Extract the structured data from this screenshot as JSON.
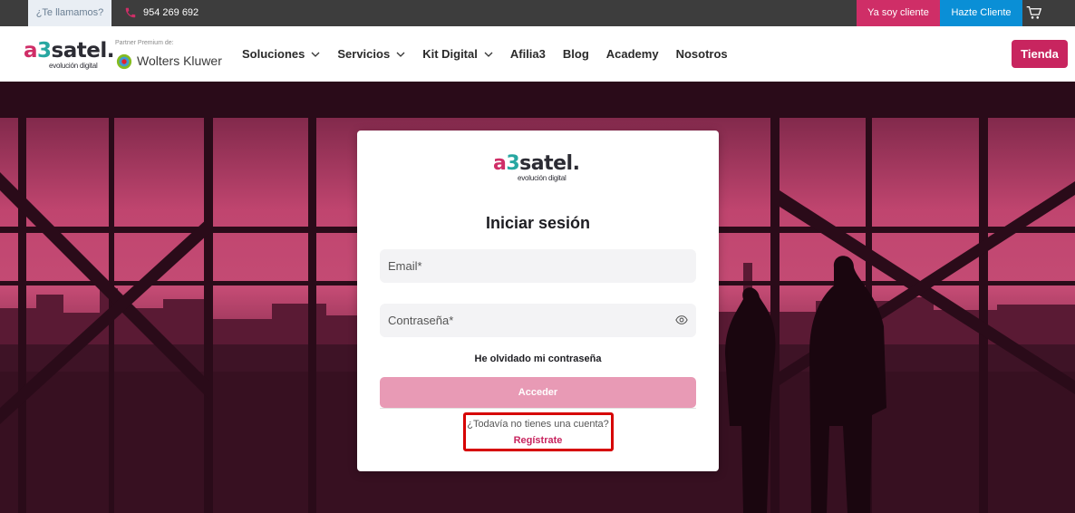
{
  "topbar": {
    "callme_label": "¿Te llamamos?",
    "phone_number": "954 269 692",
    "client_label": "Ya soy cliente",
    "new_client_label": "Hazte Cliente"
  },
  "header": {
    "logo": {
      "a": "a",
      "three": "3",
      "rest": "satel.",
      "tagline": "evolución digital"
    },
    "partner_label": "Partner Premium de:",
    "partner_name": "Wolters Kluwer",
    "nav": [
      "Soluciones",
      "Servicios",
      "Kit Digital",
      "Afilia3",
      "Blog",
      "Academy",
      "Nosotros"
    ],
    "shop_label": "Tienda"
  },
  "login": {
    "logo": {
      "a": "a",
      "three": "3",
      "rest": "satel.",
      "tagline": "evolución digital"
    },
    "title": "Iniciar sesión",
    "email_placeholder": "Email*",
    "password_placeholder": "Contraseña*",
    "forgot_label": "He olvidado mi contraseña",
    "submit_label": "Acceder",
    "no_account_text": "¿Todavía no tienes una cuenta?",
    "register_label": "Regístrate"
  },
  "colors": {
    "brand_pink": "#c8255f",
    "brand_teal": "#27a7a1",
    "brand_blue": "#0a8fd6",
    "highlight_red": "#d60000"
  }
}
